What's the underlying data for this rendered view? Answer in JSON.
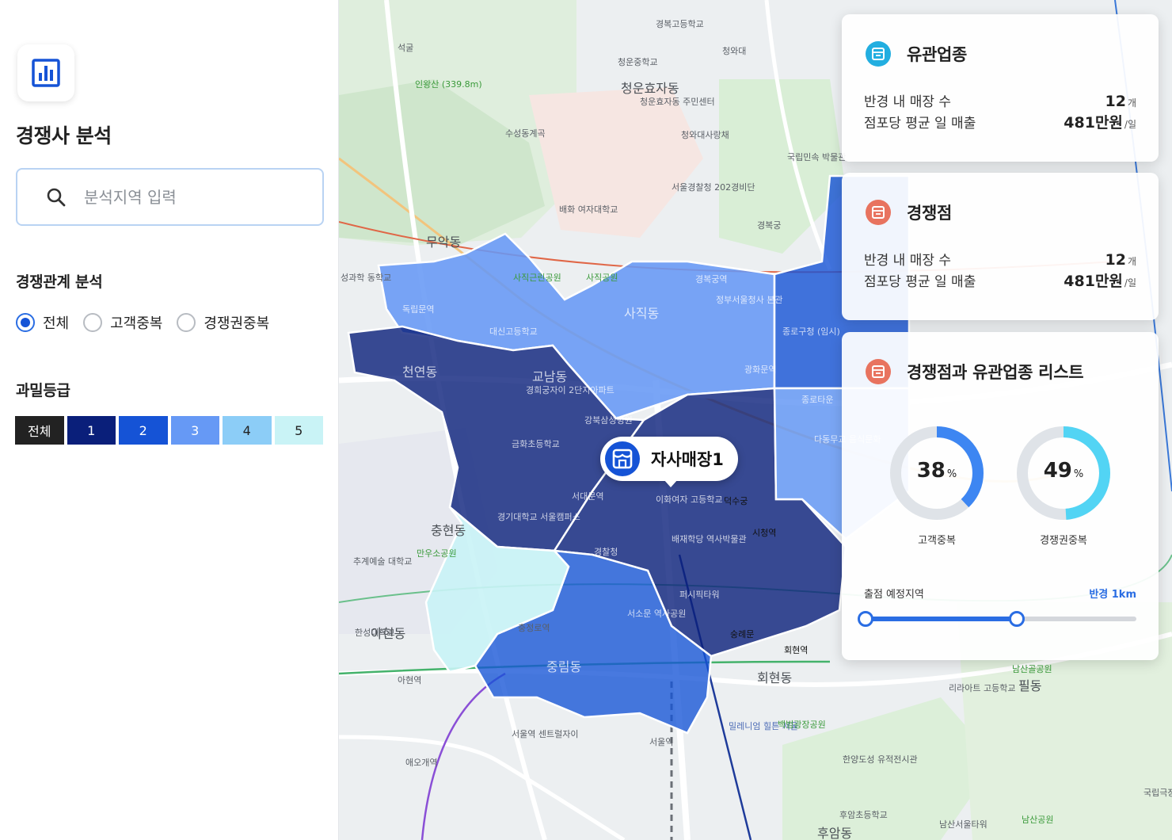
{
  "sidebar": {
    "logo_icon": "bar-chart-icon",
    "title": "경쟁사 분석",
    "search": {
      "placeholder": "분석지역 입력",
      "value": ""
    },
    "relation_section": {
      "title": "경쟁관계 분석",
      "options": [
        {
          "label": "전체",
          "checked": true
        },
        {
          "label": "고객중복",
          "checked": false
        },
        {
          "label": "경쟁권중복",
          "checked": false
        }
      ]
    },
    "density_section": {
      "title": "과밀등급",
      "grades": [
        {
          "label": "전체",
          "color": "#222222",
          "text_color": "#ffffff"
        },
        {
          "label": "1",
          "color": "#0a1f7a",
          "text_color": "#ffffff"
        },
        {
          "label": "2",
          "color": "#1553d6",
          "text_color": "#ffffff"
        },
        {
          "label": "3",
          "color": "#6699f5",
          "text_color": "#ffffff"
        },
        {
          "label": "4",
          "color": "#8ccdf7",
          "text_color": "#222222"
        },
        {
          "label": "5",
          "color": "#c9f3f6",
          "text_color": "#222222"
        }
      ]
    }
  },
  "map": {
    "store_pin": {
      "name": "자사매장1",
      "icon": "store-icon"
    },
    "labels": [
      "경복고등학교",
      "청와대",
      "청운효자동",
      "청운중학교",
      "청운효자동 주민센터",
      "청와대사랑채",
      "국립민속 박물관",
      "서울경찰청 202경비단",
      "배화 여자대학교",
      "경복궁",
      "경복궁역",
      "정부서울청사 본관",
      "광화문역",
      "사직동",
      "사직공원",
      "사직근린공원",
      "무악동",
      "독립문역",
      "대신고등학교",
      "천연동",
      "교남동",
      "경희궁자이 2단지아파트",
      "금화초등학교",
      "강북삼성병원",
      "서대문역",
      "이화여자 고등학교",
      "덕수궁",
      "시청역",
      "배재학당 역사박물관",
      "경찰청",
      "충현동",
      "만우소공원",
      "경기대학교 서울캠퍼스",
      "퍼시픽타워",
      "숭례문",
      "서소문 역사공원",
      "충정로역",
      "중림동",
      "회현역",
      "회현동",
      "아현역",
      "아현동",
      "서울역",
      "밀레니엄 힐튼 서울",
      "백범광장공원",
      "한양도성 유적전시관",
      "필동",
      "리라아트 고등학교",
      "남산골공원",
      "남산서울타워",
      "남산공원",
      "후암동",
      "후암초등학교",
      "애오개역",
      "서울역 센트럴자이",
      "인왕산 (339.8m)",
      "석굴",
      "수성동계곡",
      "종로구청 (임시)",
      "종로타운",
      "다동무교 음식문화",
      "성과학 동학교",
      "추계예술 대학교",
      "한성대학교",
      "국립극장"
    ]
  },
  "cards": {
    "related": {
      "icon": "store-icon",
      "title": "유관업종",
      "rows": [
        {
          "key": "반경 내 매장 수",
          "value": "12",
          "unit": "개"
        },
        {
          "key": "점포당 평균 일 매출",
          "value": "481만원",
          "unit": "/일"
        }
      ]
    },
    "competitor": {
      "icon": "store-icon",
      "title": "경쟁점",
      "rows": [
        {
          "key": "반경 내 매장 수",
          "value": "12",
          "unit": "개"
        },
        {
          "key": "점포당 평균 일 매출",
          "value": "481만원",
          "unit": "/일"
        }
      ]
    },
    "list": {
      "icon": "store-icon",
      "title": "경쟁점과 유관업종 리스트",
      "donuts": [
        {
          "percent": 38,
          "unit": "%",
          "caption": "고객중복",
          "color": "#3d86f2"
        },
        {
          "percent": 49,
          "unit": "%",
          "caption": "경쟁권중복",
          "color": "#52d4f4"
        }
      ],
      "slider": {
        "label": "출점 예정지역",
        "value_label": "반경 1km",
        "fill_fraction": 0.56
      }
    }
  },
  "colors": {
    "accent": "#1553d6",
    "related_icon_bg": "#22aee0",
    "competitor_icon_bg": "#e8735f"
  }
}
